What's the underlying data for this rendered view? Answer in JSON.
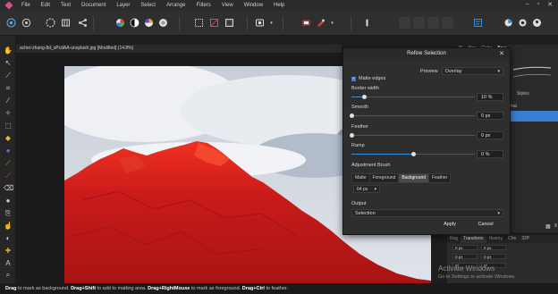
{
  "menu": [
    "File",
    "Edit",
    "Text",
    "Document",
    "Layer",
    "Select",
    "Arrange",
    "Filters",
    "View",
    "Window",
    "Help"
  ],
  "window_controls": [
    "–",
    "▫",
    "✕"
  ],
  "document": {
    "tab_title": "acher-zhang-8d_sPcdAA-unsplash.jpg [Modified] (14.8%)"
  },
  "right_tabs": [
    "Sl",
    "Nav",
    "Color",
    "Brushes"
  ],
  "right_panel": {
    "styles_label": "Styles",
    "normal_label": "rmal"
  },
  "bottom_panel": {
    "tabs": [
      "Nvg",
      "Transform",
      "History",
      "Chn",
      "32P"
    ],
    "rows": [
      {
        "a": "0 px",
        "b": "0 px"
      },
      {
        "a": "0 px",
        "b": "0 px"
      },
      {
        "a": "0°",
        "b": "0°"
      }
    ]
  },
  "watermark": {
    "title": "Activate Windows",
    "subtitle": "Go to Settings to activate Windows."
  },
  "dialog": {
    "title": "Refine Selection",
    "close": "✕",
    "preview_label": "Preview",
    "preview_value": "Overlay",
    "matte_edges_label": "Matte edges",
    "border_width": {
      "label": "Border width",
      "value": "10 %",
      "fraction": 0.1
    },
    "smooth": {
      "label": "Smooth",
      "value": "0 px",
      "fraction": 0.0
    },
    "feather": {
      "label": "Feather",
      "value": "0 px",
      "fraction": 0.0
    },
    "ramp": {
      "label": "Ramp",
      "value": "0 %",
      "fraction": 0.5
    },
    "adjustment_brush_label": "Adjustment Brush",
    "brush_tabs": [
      "Matte",
      "Foreground",
      "Background",
      "Feather"
    ],
    "active_brush_tab": 2,
    "brush_size": "64 px",
    "output_label": "Output",
    "output_value": "Selection",
    "apply_label": "Apply",
    "cancel_label": "Cancel"
  },
  "status": {
    "drag": "Drag",
    "t1": " to mark as background. ",
    "drag_shift": "Drag+Shift",
    "t2": " to add to matting area. ",
    "drag_right": "Drag+RightMouse",
    "t3": " to mark as foreground. ",
    "drag_ctrl": "Drag+Ctrl",
    "t4": " to feather."
  },
  "colors": {
    "accent": "#2f8fe0",
    "overlay_red": "#d41e1e",
    "sky": "#c4ccd6"
  }
}
